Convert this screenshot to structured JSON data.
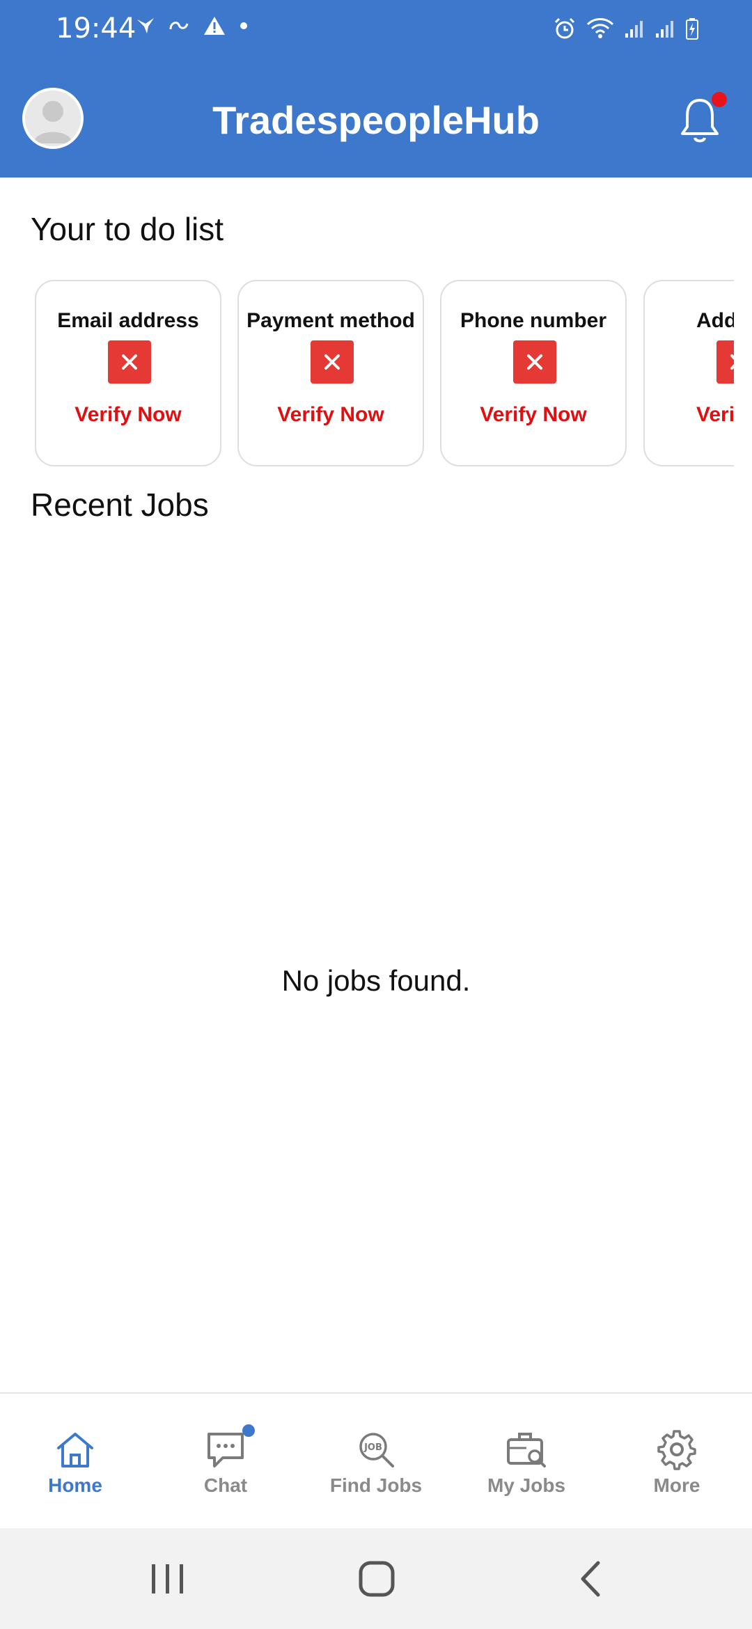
{
  "status_bar": {
    "time": "19:44"
  },
  "header": {
    "title": "TradespeopleHub",
    "accent_color": "#3d78cc",
    "notification_dot_color": "#e8141b"
  },
  "todo": {
    "title": "Your to do list",
    "items": [
      {
        "label": "Email address",
        "action": "Verify Now",
        "icon": "close-icon"
      },
      {
        "label": "Payment method",
        "action": "Verify Now",
        "icon": "close-icon"
      },
      {
        "label": "Phone number",
        "action": "Verify Now",
        "icon": "close-icon"
      },
      {
        "label": "Add",
        "action": "Verify",
        "icon": "close-icon"
      }
    ],
    "error_color": "#e53935"
  },
  "recent_jobs": {
    "title": "Recent Jobs",
    "empty_message": "No jobs found."
  },
  "bottom_nav": {
    "items": [
      {
        "label": "Home",
        "icon": "home-icon",
        "active": true
      },
      {
        "label": "Chat",
        "icon": "chat-icon",
        "active": false
      },
      {
        "label": "Find Jobs",
        "icon": "find-jobs-icon",
        "active": false
      },
      {
        "label": "My Jobs",
        "icon": "briefcase-search-icon",
        "active": false
      },
      {
        "label": "More",
        "icon": "gear-icon",
        "active": false
      }
    ]
  }
}
